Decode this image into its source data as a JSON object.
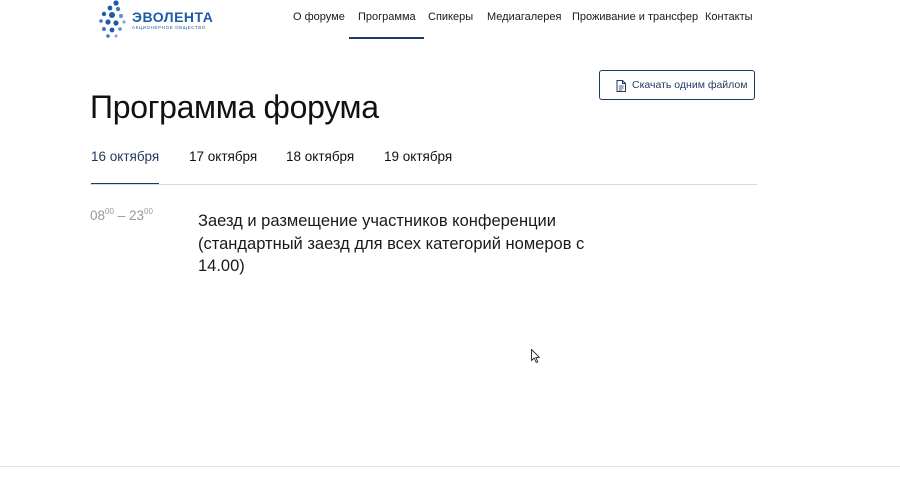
{
  "header": {
    "logo": {
      "name": "ЭВОЛЕНТА",
      "subtitle": "АКЦИОНЕРНОЕ ОБЩЕСТВО",
      "brand_color": "#1e5aa8"
    },
    "nav": [
      {
        "label": "О форуме",
        "active": false
      },
      {
        "label": "Программа",
        "active": true
      },
      {
        "label": "Спикеры",
        "active": false
      },
      {
        "label": "Медиагалерея",
        "active": false
      },
      {
        "label": "Проживание и трансфер",
        "active": false
      },
      {
        "label": "Контакты",
        "active": false
      }
    ]
  },
  "page": {
    "title": "Программа форума",
    "download_button": {
      "label": "Скачать одним файлом",
      "icon": "document-icon"
    }
  },
  "tabs": [
    {
      "label": "16 октября",
      "active": true
    },
    {
      "label": "17 октября",
      "active": false
    },
    {
      "label": "18 октября",
      "active": false
    },
    {
      "label": "19 октября",
      "active": false
    }
  ],
  "schedule": [
    {
      "start_hour": "08",
      "start_min": "00",
      "separator": "–",
      "end_hour": "23",
      "end_min": "00",
      "description": "Заезд и размещение участников конференции (стандартный заезд для всех категорий номеров с 14.00)"
    }
  ],
  "colors": {
    "accent": "#1e3a5f",
    "text": "#1a1a1a",
    "muted": "#9a9a9a",
    "divider": "#d9d9d9"
  }
}
